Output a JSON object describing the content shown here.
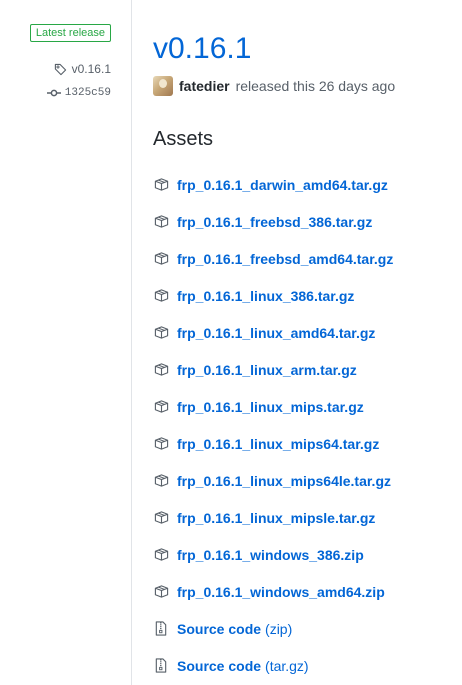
{
  "sidebar": {
    "badge": "Latest release",
    "tag": "v0.16.1",
    "commit": "1325c59"
  },
  "release": {
    "title": "v0.16.1",
    "author": "fatedier",
    "byline_text": "released this 26 days ago"
  },
  "assets": {
    "heading": "Assets",
    "files": [
      {
        "name": "frp_0.16.1_darwin_amd64.tar.gz",
        "icon": "package-icon"
      },
      {
        "name": "frp_0.16.1_freebsd_386.tar.gz",
        "icon": "package-icon"
      },
      {
        "name": "frp_0.16.1_freebsd_amd64.tar.gz",
        "icon": "package-icon"
      },
      {
        "name": "frp_0.16.1_linux_386.tar.gz",
        "icon": "package-icon"
      },
      {
        "name": "frp_0.16.1_linux_amd64.tar.gz",
        "icon": "package-icon"
      },
      {
        "name": "frp_0.16.1_linux_arm.tar.gz",
        "icon": "package-icon"
      },
      {
        "name": "frp_0.16.1_linux_mips.tar.gz",
        "icon": "package-icon"
      },
      {
        "name": "frp_0.16.1_linux_mips64.tar.gz",
        "icon": "package-icon"
      },
      {
        "name": "frp_0.16.1_linux_mips64le.tar.gz",
        "icon": "package-icon"
      },
      {
        "name": "frp_0.16.1_linux_mipsle.tar.gz",
        "icon": "package-icon"
      },
      {
        "name": "frp_0.16.1_windows_386.zip",
        "icon": "package-icon"
      },
      {
        "name": "frp_0.16.1_windows_amd64.zip",
        "icon": "package-icon"
      }
    ],
    "source": [
      {
        "name": "Source code",
        "suffix": "(zip)",
        "icon": "file-zip-icon"
      },
      {
        "name": "Source code",
        "suffix": "(tar.gz)",
        "icon": "file-zip-icon"
      }
    ]
  },
  "colors": {
    "link": "#0366d6",
    "badge_green": "#28a745",
    "muted": "#586069",
    "divider": "#e1e4e8"
  }
}
